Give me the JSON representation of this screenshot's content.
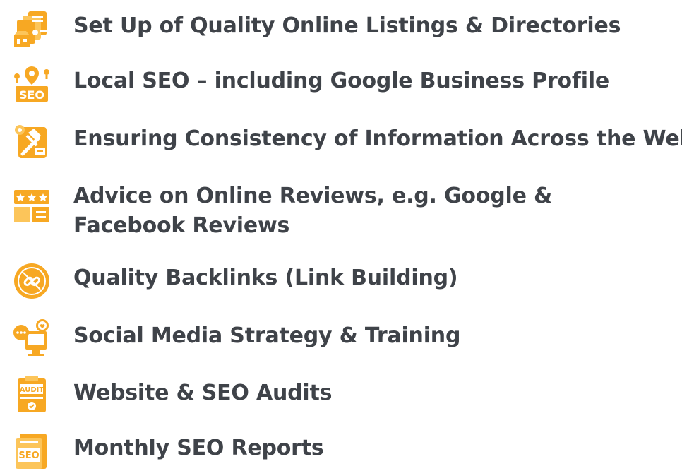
{
  "colors": {
    "accent": "#F7A823",
    "accent_light": "#FCC55A",
    "text": "#3F4349"
  },
  "services": [
    {
      "label": "Set Up of Quality Online Listings & Directories",
      "icon": "listings-directory-icon"
    },
    {
      "label": "Local SEO – including Google Business Profile",
      "icon": "local-seo-pin-icon"
    },
    {
      "label": "Ensuring Consistency of Information Across the Web",
      "icon": "tools-consistency-icon"
    },
    {
      "label": "Advice on Online Reviews, e.g. Google & Facebook Reviews",
      "icon": "reviews-box-icon"
    },
    {
      "label": "Quality Backlinks (Link Building)",
      "icon": "broken-link-icon"
    },
    {
      "label": "Social Media Strategy & Training",
      "icon": "social-media-icon"
    },
    {
      "label": "Website & SEO Audits",
      "icon": "audit-clipboard-icon"
    },
    {
      "label": "Monthly SEO Reports",
      "icon": "seo-report-icon"
    }
  ],
  "icon_texts": {
    "seo": "SEO",
    "audit": "AUDIT"
  }
}
